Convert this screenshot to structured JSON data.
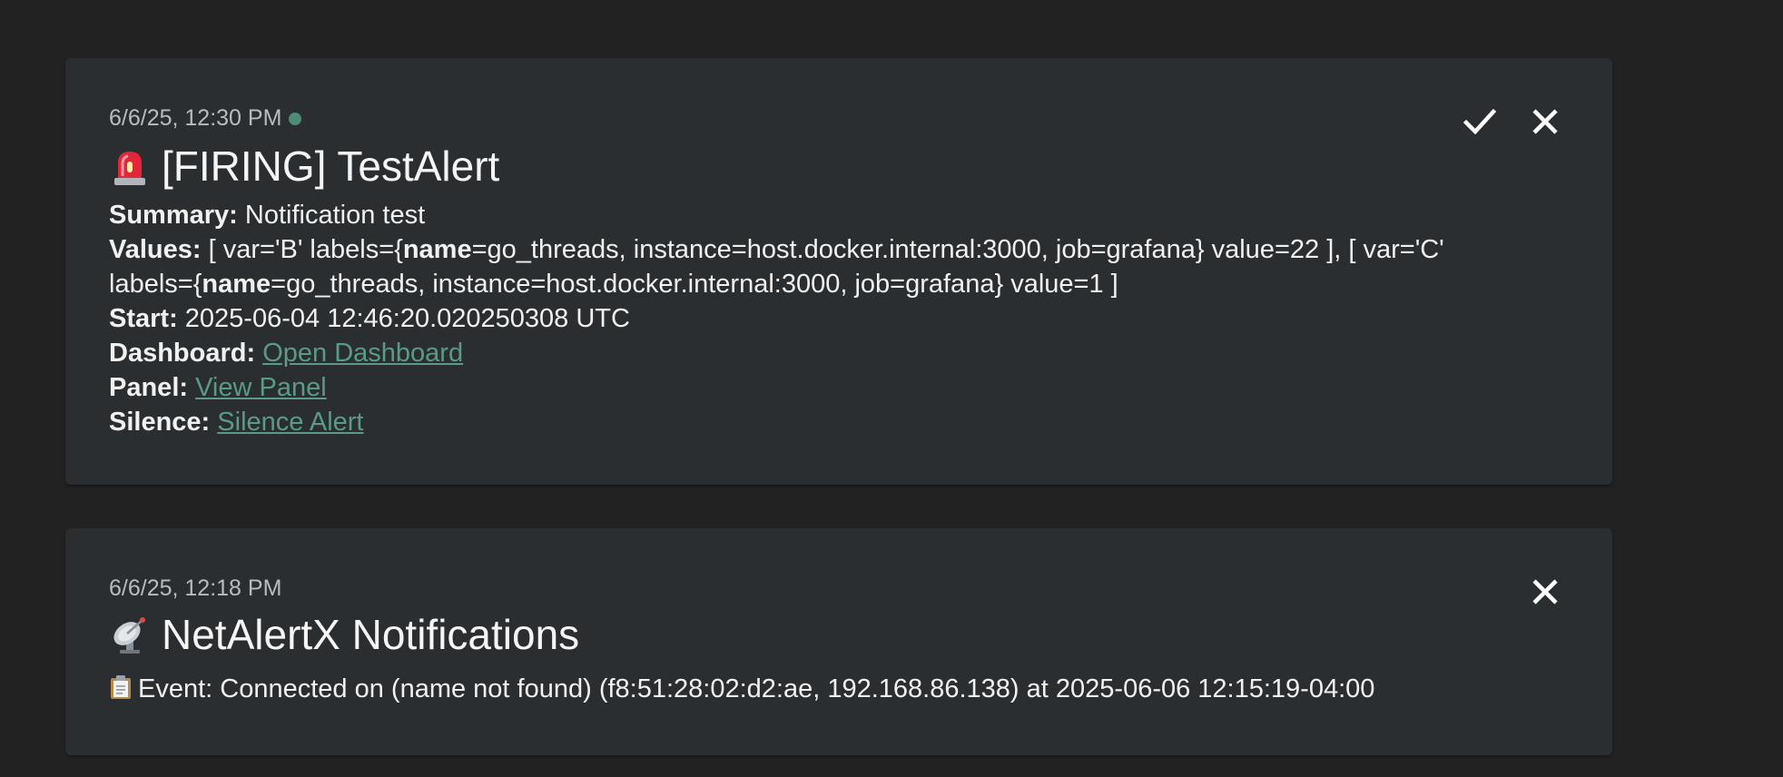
{
  "colors": {
    "background": "#222222",
    "card": "#2b2e30",
    "link": "#5a9a86",
    "status_dot": "#4e8a75"
  },
  "notifications": [
    {
      "timestamp": "6/6/25, 12:30 PM",
      "status_dot": true,
      "icon": "police-light-icon",
      "title": "[FIRING] TestAlert",
      "summary_label": "Summary:",
      "summary_value": "Notification test",
      "values_label": "Values:",
      "values_part1": "[ var='B' labels={",
      "values_name1": "name",
      "values_part2": "=go_threads, instance=host.docker.internal:3000, job=grafana} value=22 ], [",
      "values_part3": "var='C' labels={",
      "values_name2": "name",
      "values_part4": "=go_threads, instance=host.docker.internal:3000, job=grafana} value=1 ]",
      "start_label": "Start:",
      "start_value": "2025-06-04 12:46:20.020250308 UTC",
      "dashboard_label": "Dashboard:",
      "dashboard_link": "Open Dashboard",
      "panel_label": "Panel:",
      "panel_link": "View Panel",
      "silence_label": "Silence:",
      "silence_link": "Silence Alert",
      "actions": [
        "check-icon",
        "close-icon"
      ]
    },
    {
      "timestamp": "6/6/25, 12:18 PM",
      "status_dot": false,
      "icon": "satellite-antenna-icon",
      "title": "NetAlertX Notifications",
      "event_icon": "clipboard-icon",
      "event_text": "Event: Connected on (name not found) (f8:51:28:02:d2:ae, 192.168.86.138) at 2025-06-06 12:15:19-04:00",
      "actions": [
        "close-icon"
      ]
    }
  ]
}
